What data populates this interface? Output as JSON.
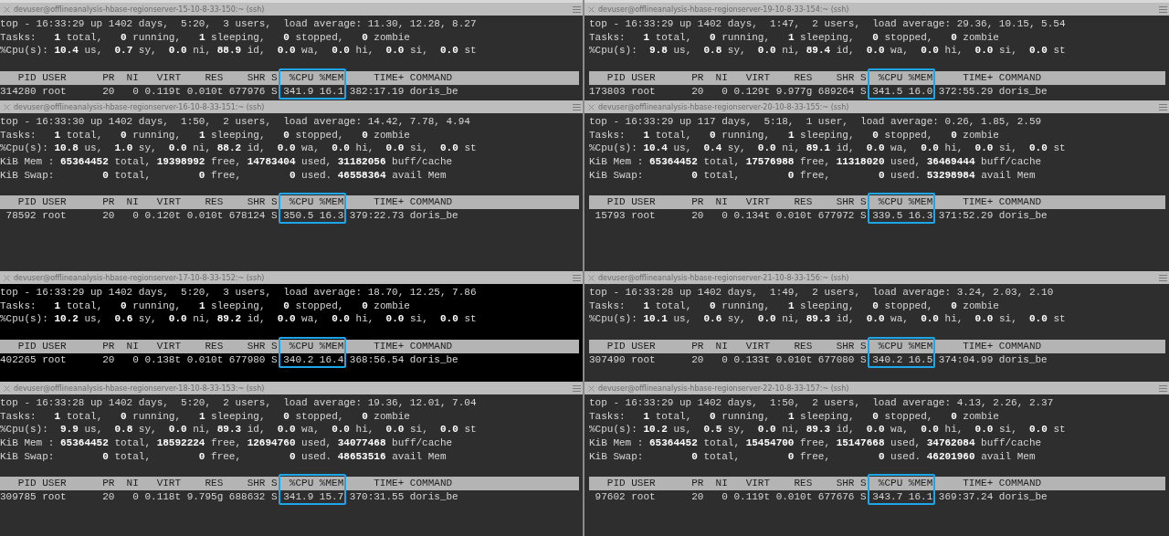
{
  "panes": [
    {
      "title": "devuser@offlineanalysis-hbase-regionserver-15-10-8-33-150:~ (ssh)",
      "focused": false,
      "highlight_box": true,
      "summary": [
        "top - 16:33:29 up 1402 days,  5:20,  3 users,  load average: 11.30, 12.28, 8.27",
        "Tasks:   **1** total,   **0** running,   **1** sleeping,   **0** stopped,   **0** zombie",
        "%Cpu(s): **10.4** us,  **0.7** sy,  **0.0** ni, **88.9** id,  **0.0** wa,  **0.0** hi,  **0.0** si,  **0.0** st"
      ],
      "header": "   PID USER      PR  NI   VIRT    RES    SHR S  %CPU %MEM     TIME+ COMMAND",
      "rows": [
        "314280 root      20   0 0.119t 0.010t 677976 S 341.9 16.1 382:17.19 doris_be"
      ]
    },
    {
      "title": "devuser@offlineanalysis-hbase-regionserver-19-10-8-33-154:~ (ssh)",
      "focused": false,
      "highlight_box": true,
      "summary": [
        "top - 16:33:29 up 1402 days,  1:47,  2 users,  load average: 29.36, 10.15, 5.54",
        "Tasks:   **1** total,   **0** running,   **1** sleeping,   **0** stopped,   **0** zombie",
        "%Cpu(s):  **9.8** us,  **0.8** sy,  **0.0** ni, **89.4** id,  **0.0** wa,  **0.0** hi,  **0.0** si,  **0.0** st"
      ],
      "header": "   PID USER      PR  NI   VIRT    RES    SHR S  %CPU %MEM     TIME+ COMMAND",
      "rows": [
        "173803 root      20   0 0.129t 9.977g 689264 S 341.5 16.0 372:55.29 doris_be"
      ]
    },
    {
      "title": "devuser@offlineanalysis-hbase-regionserver-16-10-8-33-151:~ (ssh)",
      "focused": false,
      "highlight_box": true,
      "summary": [
        "top - 16:33:30 up 1402 days,  1:50,  2 users,  load average: 14.42, 7.78, 4.94",
        "Tasks:   **1** total,   **0** running,   **1** sleeping,   **0** stopped,   **0** zombie",
        "%Cpu(s): **10.8** us,  **1.0** sy,  **0.0** ni, **88.2** id,  **0.0** wa,  **0.0** hi,  **0.0** si,  **0.0** st",
        "KiB Mem : **65364452** total, **19398992** free, **14783404** used, **31182056** buff/cache",
        "KiB Swap:        **0** total,        **0** free,        **0** used. **46558364** avail Mem"
      ],
      "header": "   PID USER      PR  NI   VIRT    RES    SHR S  %CPU %MEM     TIME+ COMMAND",
      "rows": [
        " 78592 root      20   0 0.120t 0.010t 678124 S 350.5 16.3 379:22.73 doris_be"
      ]
    },
    {
      "title": "devuser@offlineanalysis-hbase-regionserver-20-10-8-33-155:~ (ssh)",
      "focused": false,
      "highlight_box": true,
      "summary": [
        "top - 16:33:29 up 117 days,  5:18,  1 user,  load average: 0.26, 1.85, 2.59",
        "Tasks:   **1** total,   **0** running,   **1** sleeping,   **0** stopped,   **0** zombie",
        "%Cpu(s): **10.4** us,  **0.4** sy,  **0.0** ni, **89.1** id,  **0.0** wa,  **0.0** hi,  **0.0** si,  **0.0** st",
        "KiB Mem : **65364452** total, **17576988** free, **11318020** used, **36469444** buff/cache",
        "KiB Swap:        **0** total,        **0** free,        **0** used. **53298984** avail Mem"
      ],
      "header": "   PID USER      PR  NI   VIRT    RES    SHR S  %CPU %MEM     TIME+ COMMAND",
      "rows": [
        " 15793 root      20   0 0.134t 0.010t 677972 S 339.5 16.3 371:52.29 doris_be"
      ]
    },
    {
      "title": "devuser@offlineanalysis-hbase-regionserver-17-10-8-33-152:~ (ssh)",
      "focused": true,
      "highlight_box": true,
      "summary": [
        "top - 16:33:29 up 1402 days,  5:20,  3 users,  load average: 18.70, 12.25, 7.86",
        "Tasks:   **1** total,   **0** running,   **1** sleeping,   **0** stopped,   **0** zombie",
        "%Cpu(s): **10.2** us,  **0.6** sy,  **0.0** ni, **89.2** id,  **0.0** wa,  **0.0** hi,  **0.0** si,  **0.0** st"
      ],
      "header": "   PID USER      PR  NI   VIRT    RES    SHR S  %CPU %MEM     TIME+ COMMAND",
      "rows": [
        "402265 root      20   0 0.138t 0.010t 677980 S 340.2 16.4 368:56.54 doris_be"
      ]
    },
    {
      "title": "devuser@offlineanalysis-hbase-regionserver-21-10-8-33-156:~ (ssh)",
      "focused": false,
      "highlight_box": true,
      "summary": [
        "top - 16:33:28 up 1402 days,  1:49,  2 users,  load average: 3.24, 2.03, 2.10",
        "Tasks:   **1** total,   **0** running,   **1** sleeping,   **0** stopped,   **0** zombie",
        "%Cpu(s): **10.1** us,  **0.6** sy,  **0.0** ni, **89.3** id,  **0.0** wa,  **0.0** hi,  **0.0** si,  **0.0** st"
      ],
      "header": "   PID USER      PR  NI   VIRT    RES    SHR S  %CPU %MEM     TIME+ COMMAND",
      "rows": [
        "307490 root      20   0 0.133t 0.010t 677080 S 340.2 16.5 374:04.99 doris_be"
      ]
    },
    {
      "title": "devuser@offlineanalysis-hbase-regionserver-18-10-8-33-153:~ (ssh)",
      "focused": false,
      "highlight_box": true,
      "summary": [
        "top - 16:33:28 up 1402 days,  5:20,  2 users,  load average: 19.36, 12.01, 7.04",
        "Tasks:   **1** total,   **0** running,   **1** sleeping,   **0** stopped,   **0** zombie",
        "%Cpu(s):  **9.9** us,  **0.8** sy,  **0.0** ni, **89.3** id,  **0.0** wa,  **0.0** hi,  **0.0** si,  **0.0** st",
        "KiB Mem : **65364452** total, **18592224** free, **12694760** used, **34077468** buff/cache",
        "KiB Swap:        **0** total,        **0** free,        **0** used. **48653516** avail Mem"
      ],
      "header": "   PID USER      PR  NI   VIRT    RES    SHR S  %CPU %MEM     TIME+ COMMAND",
      "rows": [
        "309785 root      20   0 0.118t 9.795g 688632 S 341.9 15.7 370:31.55 doris_be"
      ]
    },
    {
      "title": "devuser@offlineanalysis-hbase-regionserver-22-10-8-33-157:~ (ssh)",
      "focused": false,
      "highlight_box": true,
      "summary": [
        "top - 16:33:29 up 1402 days,  1:50,  2 users,  load average: 4.13, 2.26, 2.37",
        "Tasks:   **1** total,   **0** running,   **1** sleeping,   **0** stopped,   **0** zombie",
        "%Cpu(s): **10.2** us,  **0.5** sy,  **0.0** ni, **89.3** id,  **0.0** wa,  **0.0** hi,  **0.0** si,  **0.0** st",
        "KiB Mem : **65364452** total, **15454700** free, **15147668** used, **34762084** buff/cache",
        "KiB Swap:        **0** total,        **0** free,        **0** used. **46201960** avail Mem"
      ],
      "header": "   PID USER      PR  NI   VIRT    RES    SHR S  %CPU %MEM     TIME+ COMMAND",
      "rows": [
        " 97602 root      20   0 0.119t 0.010t 677676 S 343.7 16.1 369:37.24 doris_be"
      ]
    }
  ]
}
